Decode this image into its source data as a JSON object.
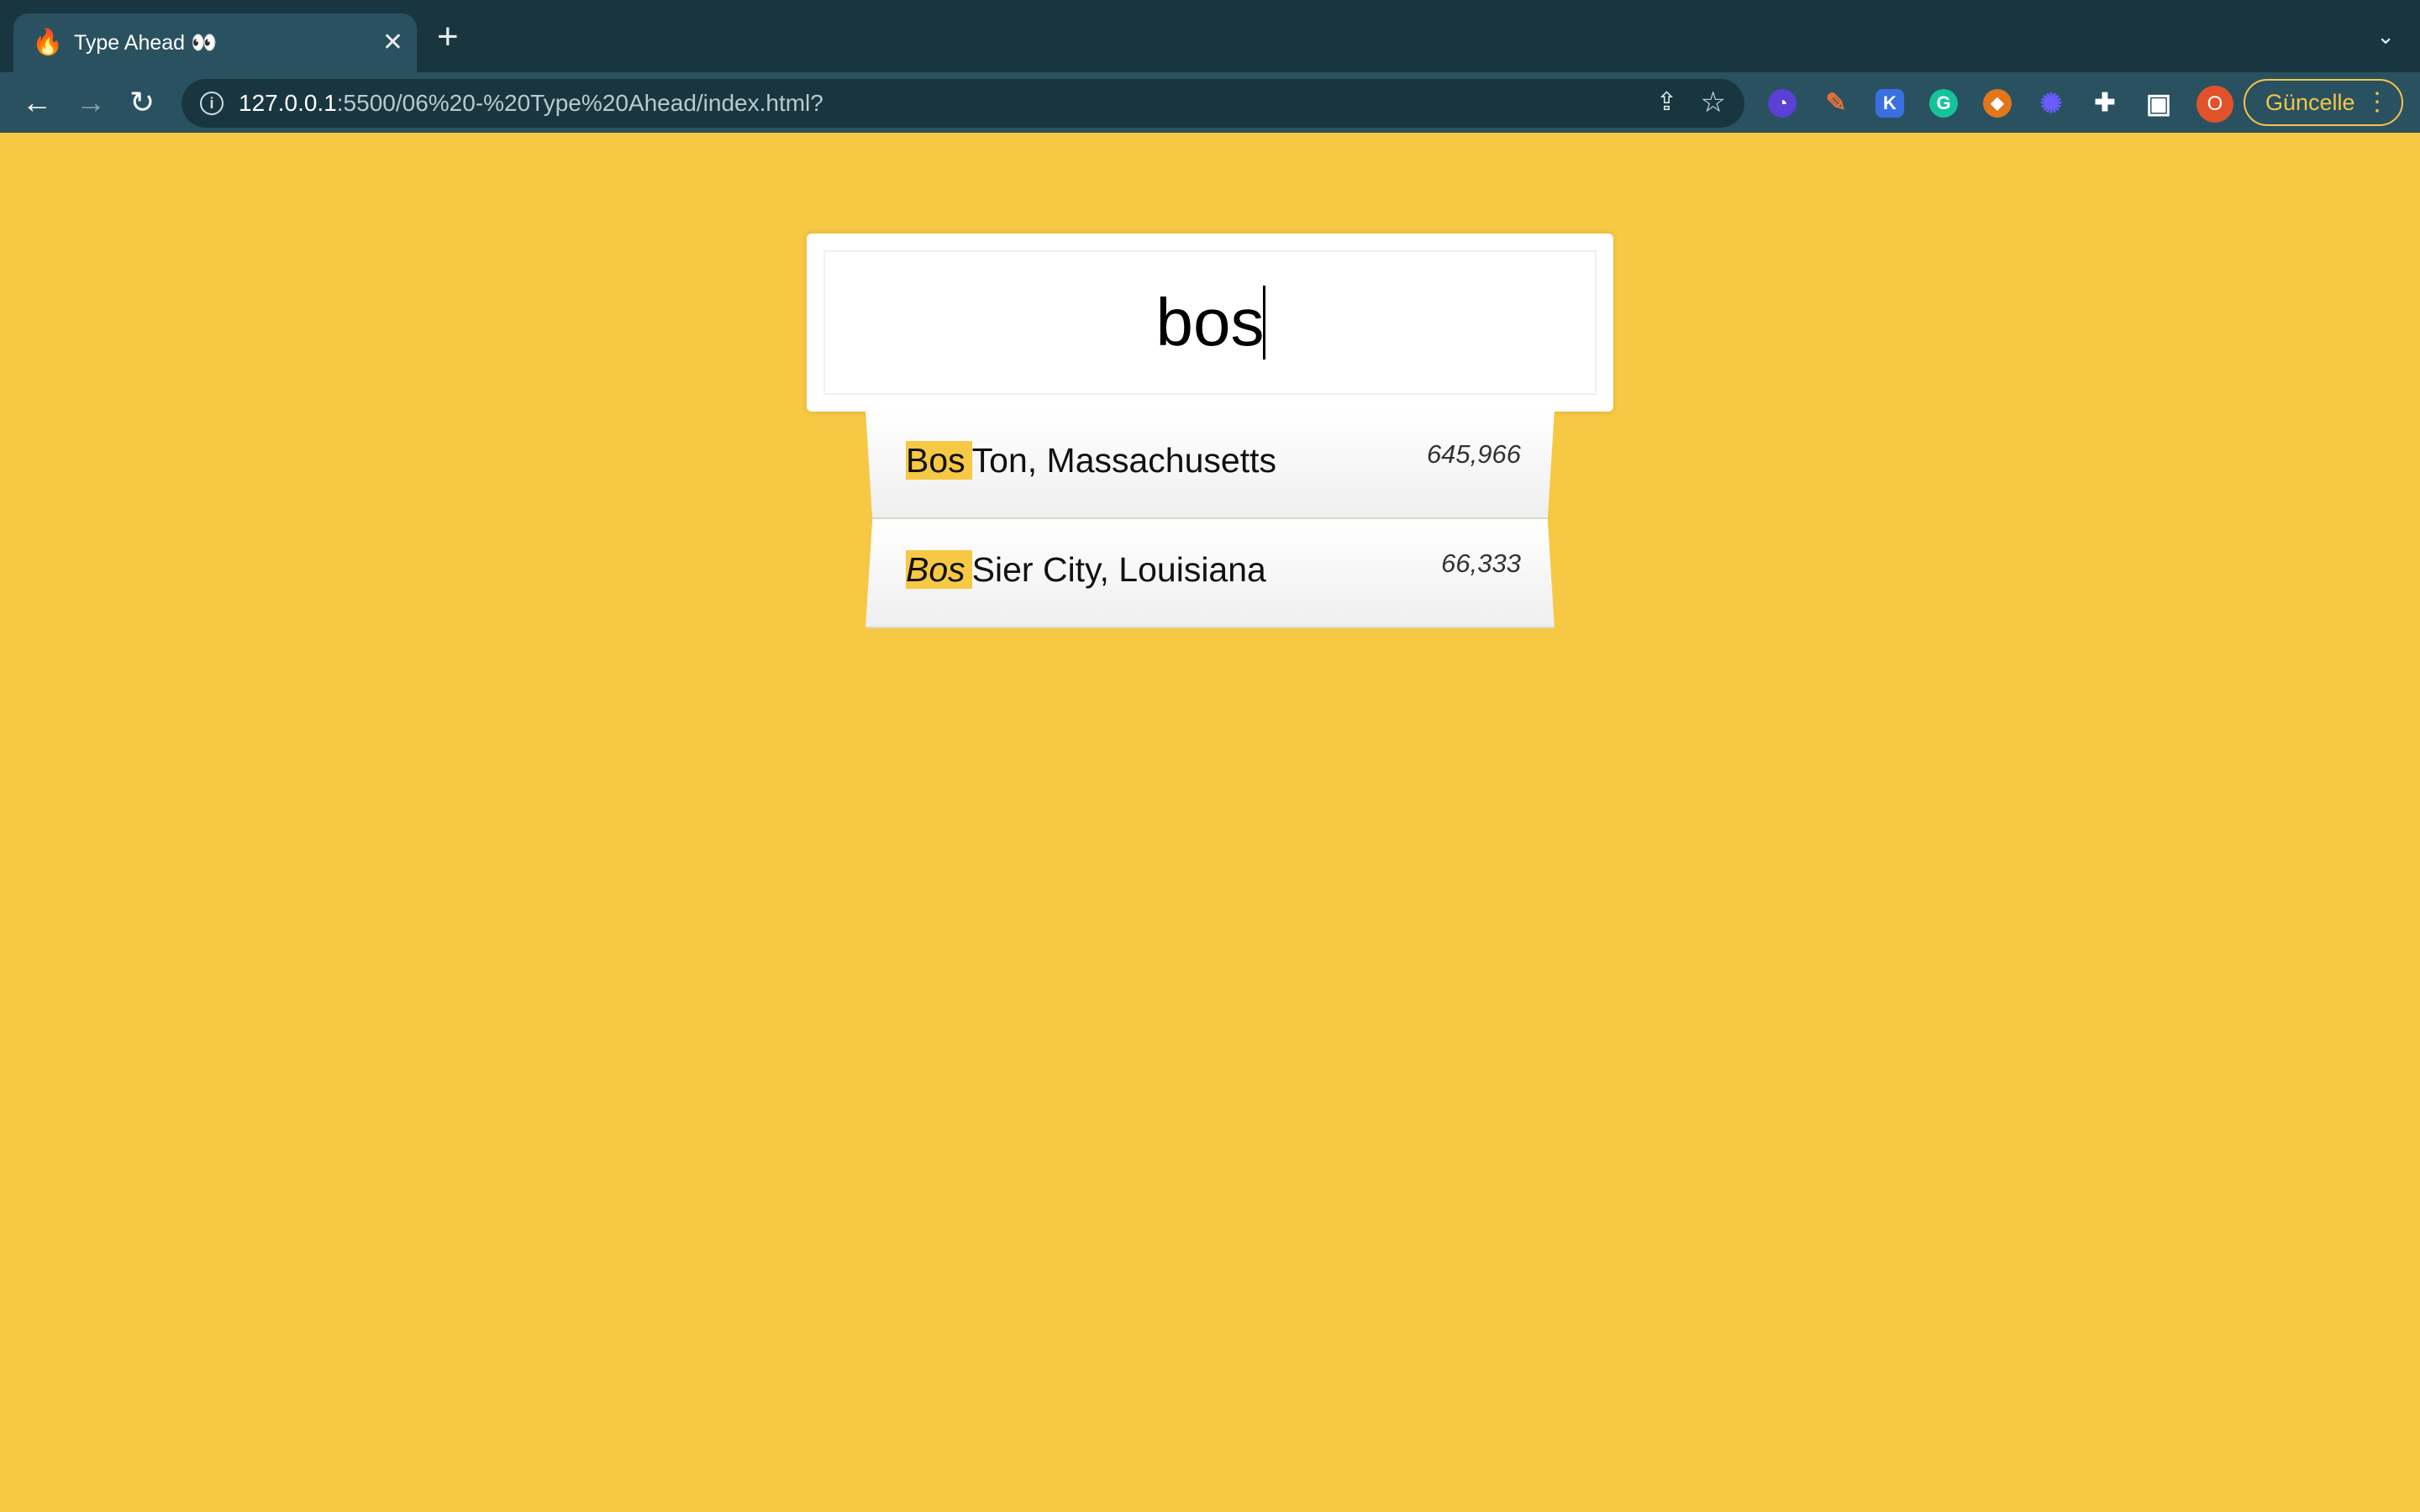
{
  "browser": {
    "tab": {
      "title": "Type Ahead 👀",
      "favicon": "fire-icon",
      "close_icon": "close-icon"
    },
    "new_tab_icon": "plus-icon",
    "tab_menu_icon": "chevron-down-icon",
    "nav": {
      "back_icon": "arrow-left-icon",
      "forward_icon": "arrow-right-icon",
      "reload_icon": "reload-icon"
    },
    "url": {
      "host": "127.0.0.1",
      "path": ":5500/06%20-%20Type%20Ahead/index.html?"
    },
    "omnibox_icons": [
      "info-icon",
      "share-icon",
      "star-icon"
    ],
    "extensions": [
      {
        "icon": "ghost-extension-icon",
        "color": "#5b3fd6",
        "glyph": "👻"
      },
      {
        "icon": "pen-extension-icon",
        "color": "#e8703a",
        "glyph": "✎"
      },
      {
        "icon": "k-extension-icon",
        "color": "#3a6fe0",
        "glyph": "K"
      },
      {
        "icon": "grammarly-icon",
        "color": "#15c39a",
        "glyph": "G"
      },
      {
        "icon": "metamask-icon",
        "color": "#e2761b",
        "glyph": "🦊"
      },
      {
        "icon": "sun-extension-icon",
        "color": "#6a5cff",
        "glyph": "✺"
      },
      {
        "icon": "puzzle-icon",
        "color": "#2a5160",
        "glyph": "✚"
      },
      {
        "icon": "sidepanel-icon",
        "color": "#2a5160",
        "glyph": "▣"
      }
    ],
    "profile_initial": "O",
    "update_button": "Güncelle",
    "accent_color": "#f4c54a"
  },
  "page": {
    "background": "#f6c844",
    "search": {
      "value": "bos",
      "placeholder": ""
    },
    "suggestions": [
      {
        "highlight": "Bos",
        "rest": "Ton, Massachusetts",
        "population": "645,966"
      },
      {
        "highlight": "Bos",
        "rest": "Sier City, Louisiana",
        "population": "66,333"
      }
    ]
  }
}
